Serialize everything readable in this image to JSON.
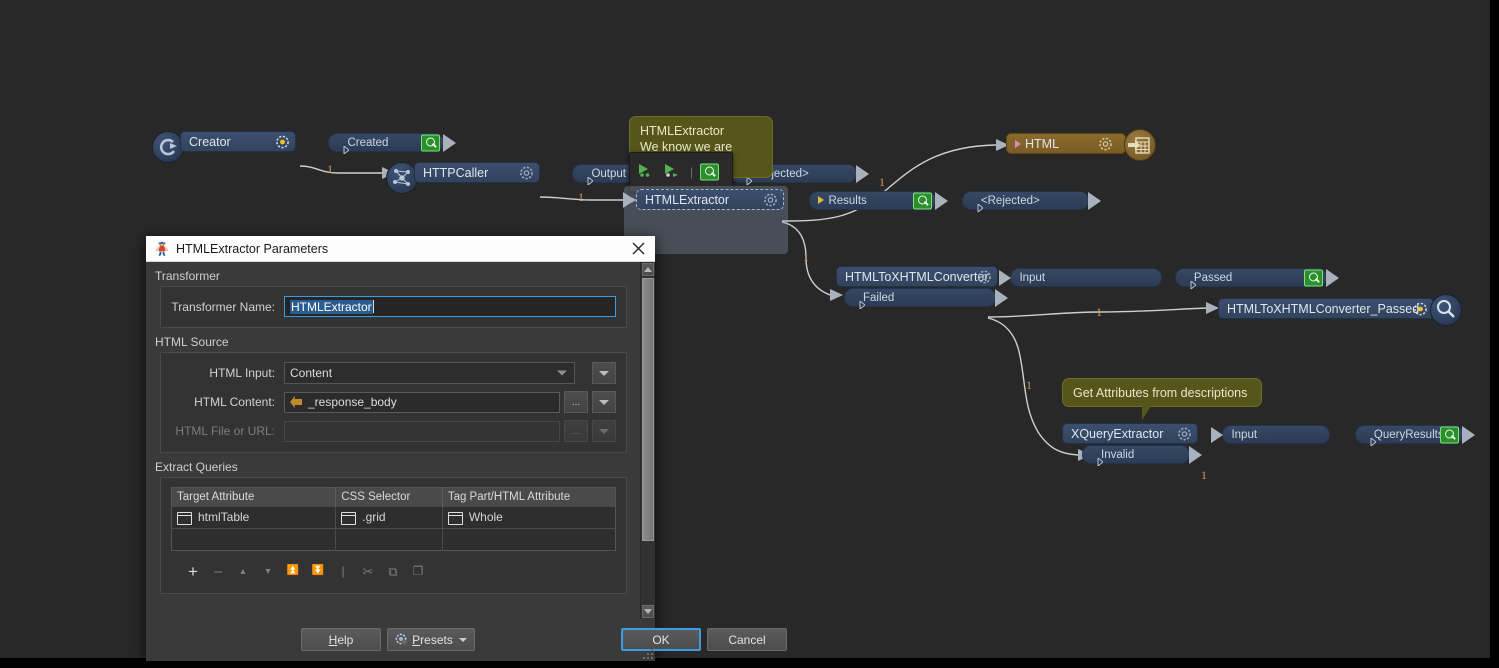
{
  "canvas": {
    "nodes": [
      {
        "id": "creator",
        "name": "Creator",
        "ports": [
          {
            "label": "Created",
            "marker": "hollow-triangle",
            "has_inspect": true
          }
        ]
      },
      {
        "id": "httpcaller",
        "name": "HTTPCaller",
        "ports": [
          {
            "label": "Output",
            "marker": "hollow-triangle",
            "has_inspect": true
          },
          {
            "label": "<Rejected>",
            "marker": "hollow-triangle",
            "has_inspect": false
          }
        ]
      },
      {
        "id": "htmlextractor",
        "name": "HTMLExtractor",
        "selected": true,
        "ports": [
          {
            "label": "Results",
            "marker": "filled-triangle",
            "has_inspect": true
          },
          {
            "label": "<Rejected>",
            "marker": "hollow-triangle",
            "has_inspect": false
          }
        ]
      },
      {
        "id": "html-writer",
        "name": "HTML",
        "kind": "writer"
      },
      {
        "id": "htmltoxhtmlconverter",
        "name": "HTMLToXHTMLConverter",
        "ports": [
          {
            "label": "Input",
            "marker": "none",
            "has_inspect": false
          },
          {
            "label": "Passed",
            "marker": "hollow-triangle",
            "has_inspect": true
          },
          {
            "label": "Failed",
            "marker": "hollow-triangle",
            "has_inspect": false
          }
        ]
      },
      {
        "id": "htmltoxhtmlconverter-passed",
        "name": "HTMLToXHTMLConverter_Passed",
        "kind": "inspector"
      },
      {
        "id": "xqueryextractor",
        "name": "XQueryExtractor",
        "ports": [
          {
            "label": "Input",
            "marker": "none",
            "has_inspect": false
          },
          {
            "label": "QueryResults",
            "marker": "hollow-triangle",
            "has_inspect": true
          },
          {
            "label": "Invalid",
            "marker": "hollow-triangle",
            "has_inspect": false
          }
        ]
      }
    ],
    "annotations": [
      {
        "id": "htmlextractor-note",
        "title": "HTMLExtractor",
        "body": "We know we are"
      },
      {
        "id": "xquery-note",
        "text": "Get Attributes from descriptions"
      }
    ],
    "connection_labels": [
      "1",
      "1",
      "1",
      "1",
      "1",
      "1",
      "1"
    ],
    "mini_toolbar": {
      "buttons": [
        "breakpoint-before-icon",
        "breakpoint-after-icon",
        "inspect-icon"
      ]
    }
  },
  "dialog": {
    "title": "HTMLExtractor Parameters",
    "title_icon": "fme-workbench-icon",
    "close_icon": "close-icon",
    "sections": {
      "transformer": {
        "label": "Transformer",
        "name_label": "Transformer Name:",
        "name_value": "HTMLExtractor"
      },
      "html_source": {
        "label": "HTML Source",
        "input_label": "HTML Input:",
        "input_value": "Content",
        "content_label": "HTML Content:",
        "content_value": "_response_body",
        "file_label": "HTML File or URL:",
        "file_value": "",
        "ellipsis_label": "...",
        "dropdown_icon": "chevron-down-icon"
      },
      "extract_queries": {
        "label": "Extract Queries",
        "columns": [
          "Target Attribute",
          "CSS Selector",
          "Tag Part/HTML Attribute"
        ],
        "rows": [
          [
            "htmlTable",
            ".grid",
            "Whole"
          ],
          [
            "",
            "",
            ""
          ]
        ],
        "toolbar": [
          {
            "name": "add-row-button",
            "glyph": "+",
            "dimmed": false
          },
          {
            "name": "remove-row-button",
            "glyph": "–",
            "dimmed": true
          },
          {
            "name": "move-up-button",
            "glyph": "▲",
            "dimmed": true
          },
          {
            "name": "move-down-button",
            "glyph": "▼",
            "dimmed": true
          },
          {
            "name": "move-to-top-button",
            "glyph": "⏫",
            "dimmed": true
          },
          {
            "name": "move-to-bottom-button",
            "glyph": "⏬",
            "dimmed": true
          },
          {
            "name": "separator",
            "glyph": "|",
            "dimmed": true
          },
          {
            "name": "cut-button",
            "glyph": "✂",
            "dimmed": true
          },
          {
            "name": "copy-button",
            "glyph": "⧉",
            "dimmed": true
          },
          {
            "name": "paste-button",
            "glyph": "❐",
            "dimmed": true
          }
        ]
      }
    },
    "footer": {
      "help": "Help",
      "presets": "Presets",
      "ok": "OK",
      "cancel": "Cancel"
    },
    "scrollbar": {
      "up_icon": "scroll-up-icon",
      "down_icon": "scroll-down-icon"
    }
  }
}
